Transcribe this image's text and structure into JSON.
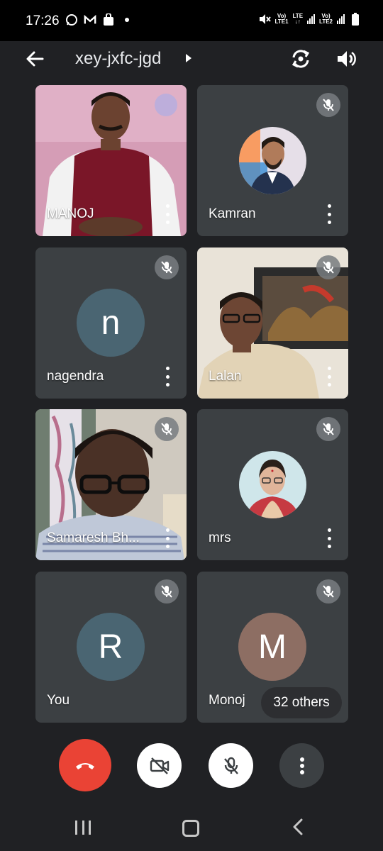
{
  "status_bar": {
    "time": "17:26",
    "left_icons": [
      "whatsapp-icon",
      "gmail-icon",
      "bag-icon",
      "dot-icon"
    ],
    "sim1_label_top": "Vo)",
    "sim1_label_bottom": "LTE1",
    "lte_label": "LTE",
    "sim2_label_top": "Vo)",
    "sim2_label_bottom": "LTE2"
  },
  "header": {
    "meeting_code": "xey-jxfc-jgd"
  },
  "participants": [
    {
      "name": "MANOJ",
      "type": "video",
      "muted": false
    },
    {
      "name": "Kamran",
      "type": "photo",
      "muted": true
    },
    {
      "name": "nagendra",
      "type": "letter",
      "letter": "n",
      "avatar_color": "#4a6572",
      "muted": true
    },
    {
      "name": "Lalan",
      "type": "video",
      "muted": true
    },
    {
      "name": "Samaresh Bh...",
      "type": "video",
      "muted": true
    },
    {
      "name": "mrs",
      "type": "photo",
      "muted": true
    },
    {
      "name": "You",
      "type": "letter",
      "letter": "R",
      "avatar_color": "#4a6572",
      "muted": true
    },
    {
      "name": "Monoj",
      "type": "letter",
      "letter": "M",
      "avatar_color": "#8d6e63",
      "muted": true
    }
  ],
  "others_chip": "32 others",
  "controls": {
    "end_call": "end-call-icon",
    "camera": "camera-off-icon",
    "mic": "mic-off-icon",
    "more": "more-vert-icon"
  },
  "colors": {
    "background": "#202124",
    "tile": "#3c4043",
    "end_call": "#ea4335"
  }
}
